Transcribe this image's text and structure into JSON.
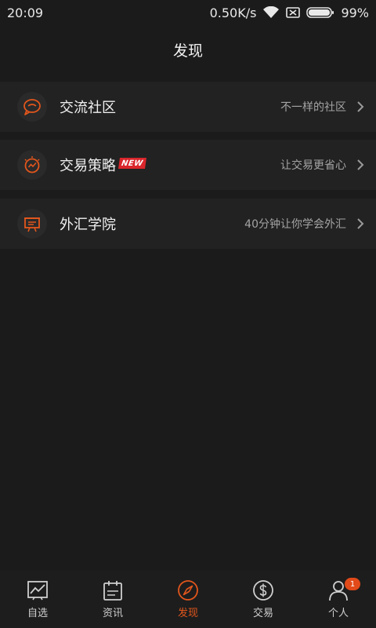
{
  "status": {
    "time": "20:09",
    "speed": "0.50K/s",
    "battery": "99%",
    "icons": [
      "wifi-icon",
      "sim-icon",
      "battery-icon"
    ]
  },
  "header": {
    "title": "发现"
  },
  "menu": [
    {
      "label": "交流社区",
      "desc": "不一样的社区",
      "icon": "chat-bubble-icon"
    },
    {
      "label": "交易策略",
      "badge": "NEW",
      "desc": "让交易更省心",
      "icon": "idea-chart-icon"
    },
    {
      "label": "外汇学院",
      "desc": "40分钟让你学会外汇",
      "icon": "presentation-board-icon"
    }
  ],
  "tabs": [
    {
      "label": "自选",
      "icon": "chart-line-icon",
      "active": false
    },
    {
      "label": "资讯",
      "icon": "calendar-icon",
      "active": false
    },
    {
      "label": "发现",
      "icon": "compass-icon",
      "active": true
    },
    {
      "label": "交易",
      "icon": "dollar-coin-icon",
      "active": false
    },
    {
      "label": "个人",
      "icon": "person-icon",
      "active": false,
      "badge": "1"
    }
  ],
  "colors": {
    "accent": "#e2561c",
    "background": "#1b1b1b",
    "row": "#222222",
    "new_badge": "#d9262b"
  }
}
